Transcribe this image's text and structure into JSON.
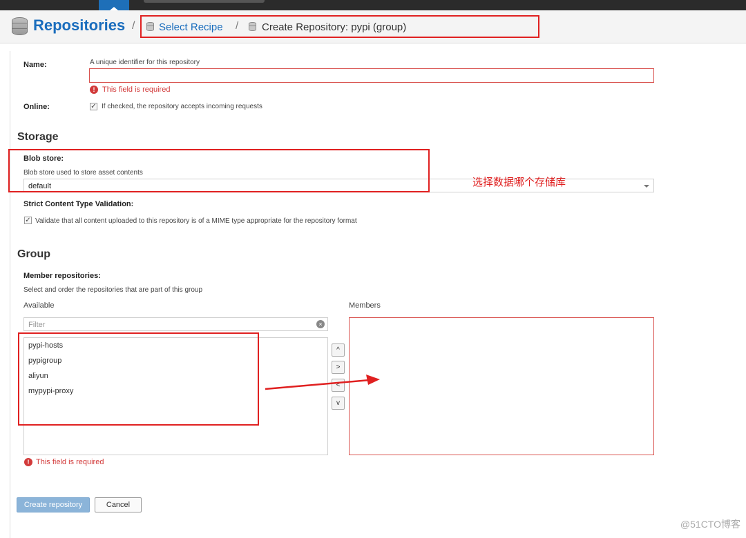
{
  "header": {
    "title": "Repositories",
    "separator": "/",
    "breadcrumb_1": "Select Recipe",
    "breadcrumb_2": "Create Repository: pypi (group)"
  },
  "name_field": {
    "label": "Name:",
    "help": "A unique identifier for this repository",
    "value": "",
    "error": "This field is required"
  },
  "online_field": {
    "label": "Online:",
    "checked": true,
    "help": "If checked, the repository accepts incoming requests"
  },
  "storage": {
    "title": "Storage",
    "blob_label": "Blob store:",
    "blob_help": "Blob store used to store asset contents",
    "blob_value": "default",
    "strict_label": "Strict Content Type Validation:",
    "strict_checked": true,
    "strict_help": "Validate that all content uploaded to this repository is of a MIME type appropriate for the repository format"
  },
  "annotation": "选择数据哪个存储库",
  "group": {
    "title": "Group",
    "members_label": "Member repositories:",
    "members_help": "Select and order the repositories that are part of this group",
    "available_label": "Available",
    "members_col_label": "Members",
    "filter_placeholder": "Filter",
    "available_items": [
      "pypi-hosts",
      "pypigroup",
      "aliyun",
      "mypypi-proxy"
    ],
    "move_buttons": [
      "^",
      ">",
      "<",
      "v"
    ],
    "error": "This field is required"
  },
  "actions": {
    "create_label": "Create repository",
    "cancel_label": "Cancel"
  },
  "watermark": "@51CTO博客",
  "colors": {
    "accent": "#1a6dbd",
    "error": "#d23a3a",
    "annotation": "#e02020"
  }
}
